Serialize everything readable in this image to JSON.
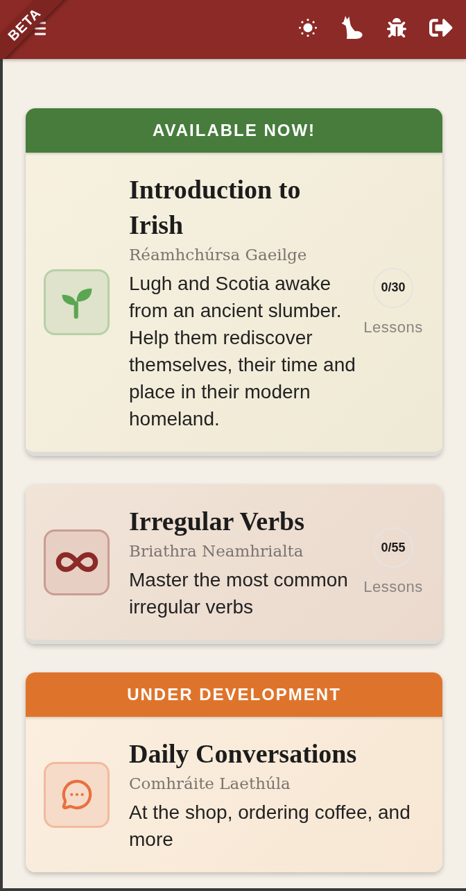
{
  "header": {
    "ribbon": "BETA"
  },
  "courses": [
    {
      "banner": {
        "label": "AVAILABLE NOW!",
        "color": "#477c3d"
      },
      "color": "#5aa653",
      "title": "Introduction to Irish",
      "subtitle": "Réamhchúrsa Gaeilge",
      "description": "Lugh and Scotia awake from an ancient slumber. Help them rediscover themselves, their time and place in their modern homeland.",
      "progress": "0/30",
      "progress_label": "Lessons"
    },
    {
      "color": "#8b2a26",
      "title": "Irregular Verbs",
      "subtitle": "Briathra Neamhrialta",
      "description": "Master the most common irregular verbs",
      "progress": "0/55",
      "progress_label": "Lessons"
    },
    {
      "banner": {
        "label": "UNDER DEVELOPMENT",
        "color": "#de742c"
      },
      "color": "#e8703f",
      "title": "Daily Conversations",
      "subtitle": "Comhráite Laethúla",
      "description": "At the shop, ordering coffee, and more"
    }
  ]
}
